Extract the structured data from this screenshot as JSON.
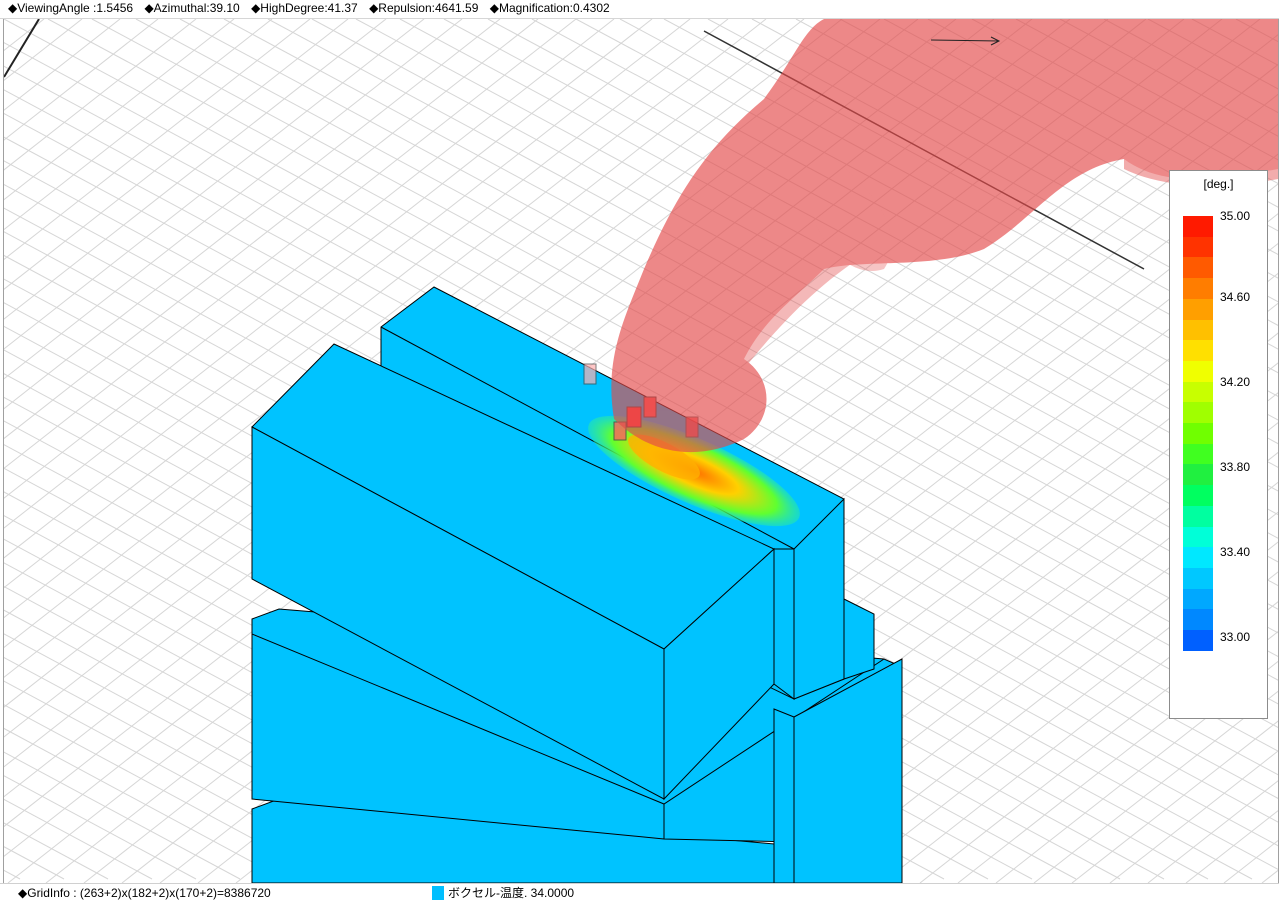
{
  "header": {
    "viewing_angle": "◆ViewingAngle :1.5456",
    "azimuthal": "◆Azimuthal:39.10",
    "high_degree": "◆HighDegree:41.37",
    "repulsion": "◆Repulsion:4641.59",
    "magnification": "◆Magnification:0.4302"
  },
  "legend": {
    "unit": "[deg.]",
    "ticks": [
      "35.00",
      "34.60",
      "34.20",
      "33.80",
      "33.40",
      "33.00"
    ],
    "colors": [
      "#ff1a00",
      "#ff3300",
      "#ff5a00",
      "#ff7d00",
      "#ff9f00",
      "#ffc000",
      "#ffe000",
      "#f0ff00",
      "#c8ff00",
      "#a0ff00",
      "#70ff00",
      "#40ff20",
      "#20f040",
      "#00ff60",
      "#00ffa0",
      "#00ffd8",
      "#00e8ff",
      "#00c8ff",
      "#00a8ff",
      "#0088ff",
      "#0060ff"
    ]
  },
  "status": {
    "grid_info": "◆GridInfo : (263+2)x(182+2)x(170+2)=8386720",
    "voxel_info": "ボクセル-温度.  34.0000",
    "voxel_color": "#00bfff"
  },
  "scene": {
    "block_color": "#00c3ff",
    "plume_color": "#e44a4a",
    "grid_color": "#d6d6d6"
  }
}
